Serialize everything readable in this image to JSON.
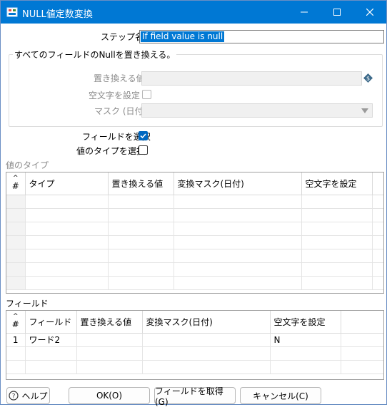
{
  "window": {
    "title": "NULL値定数変換"
  },
  "step": {
    "label": "ステップ名",
    "value": "If field value is null"
  },
  "replace_all_group": {
    "title": "すべてのフィールドのNullを置き換える。",
    "replace_value_label": "置き換える値",
    "empty_string_label": "空文字を設定",
    "mask_label": "マスク (日付)"
  },
  "select_fields": {
    "label": "フィールドを選択",
    "checked": true
  },
  "select_value_type": {
    "label": "値のタイプを選択",
    "checked": false
  },
  "value_types": {
    "section_label": "値のタイプ",
    "columns": [
      "#",
      "タイプ",
      "置き換える値",
      "変換マスク(日付)",
      "空文字を設定"
    ],
    "rows": []
  },
  "fields": {
    "section_label": "フィールド",
    "columns": [
      "#",
      "フィールド",
      "置き換える値",
      "変換マスク(日付)",
      "空文字を設定"
    ],
    "rows": [
      [
        "1",
        "ワード2",
        "",
        "",
        "N"
      ]
    ]
  },
  "buttons": {
    "help": "ヘルプ",
    "ok": "OK(O)",
    "get_fields": "フィールドを取得(G)",
    "cancel": "キャンセル(C)"
  },
  "colors": {
    "titlebar": "#0078d4",
    "checkbox": "#0067c0"
  }
}
